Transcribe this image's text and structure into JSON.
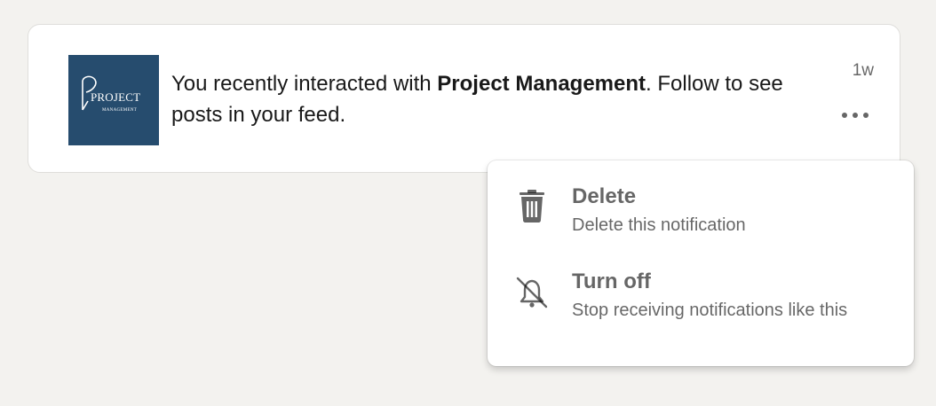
{
  "notification": {
    "logo": {
      "title": "PROJECT",
      "subtitle": "MANAGEMENT",
      "background_color": "#264c6e"
    },
    "text_prefix": "You recently interacted with ",
    "text_entity": "Project Management",
    "text_suffix": ". Follow to see posts in your feed.",
    "time": "1w",
    "more_icon": "more-horizontal-icon"
  },
  "menu": {
    "items": [
      {
        "icon": "trash-icon",
        "title": "Delete",
        "description": "Delete this notification"
      },
      {
        "icon": "bell-off-icon",
        "title": "Turn off",
        "description": "Stop receiving notifications like this"
      }
    ]
  }
}
